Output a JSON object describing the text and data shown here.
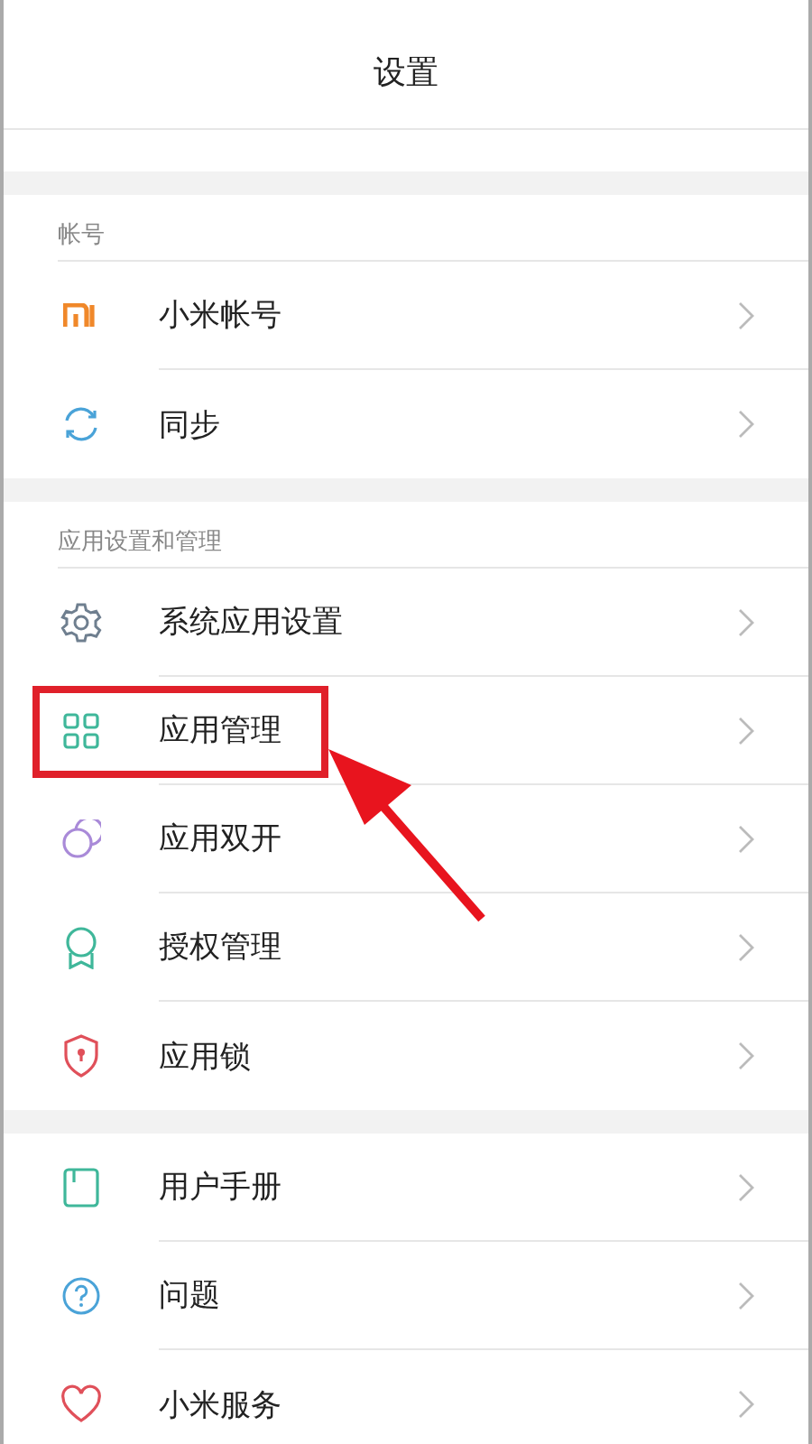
{
  "header": {
    "title": "设置"
  },
  "sections": [
    {
      "title": "帐号",
      "items": [
        {
          "label": "小米帐号",
          "kind": "mi",
          "highlighted": false
        },
        {
          "label": "同步",
          "kind": "sync",
          "highlighted": false
        }
      ]
    },
    {
      "title": "应用设置和管理",
      "items": [
        {
          "label": "系统应用设置",
          "kind": "gear",
          "highlighted": false
        },
        {
          "label": "应用管理",
          "kind": "grid",
          "highlighted": true
        },
        {
          "label": "应用双开",
          "kind": "circles",
          "highlighted": false
        },
        {
          "label": "授权管理",
          "kind": "award",
          "highlighted": false
        },
        {
          "label": "应用锁",
          "kind": "shield",
          "highlighted": false
        }
      ]
    },
    {
      "items": [
        {
          "label": "用户手册",
          "kind": "book",
          "highlighted": false
        },
        {
          "label": "问题",
          "kind": "question",
          "highlighted": false
        },
        {
          "label": "小米服务",
          "kind": "heart",
          "highlighted": false
        }
      ]
    }
  ]
}
